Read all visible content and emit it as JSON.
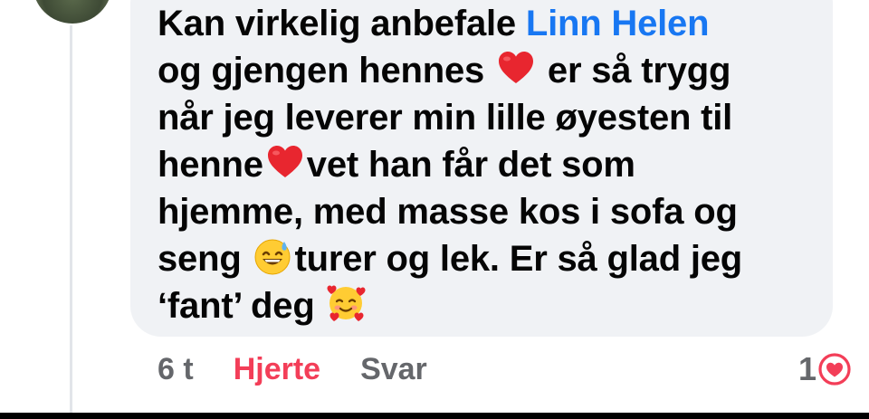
{
  "comment": {
    "line1_pre": "Kan virkelig anbefale ",
    "mention": "Linn Helen",
    "line2_pre": "og gjengen hennes ",
    "line2_post": " er så trygg",
    "line3": "når jeg leverer min lille øyesten til",
    "line4_pre": "henne",
    "line4_post": "vet han får det som",
    "line5": "hjemme, med masse kos i sofa og",
    "line6_pre": "seng ",
    "line6_post": "turer og lek. Er så glad jeg",
    "line7_pre": "‘fant’ deg "
  },
  "actions": {
    "time": "6 t",
    "heart_label": "Hjerte",
    "reply_label": "Svar"
  },
  "reactions": {
    "count": "1",
    "icon": "heart-outline-icon",
    "color": "#f33e58"
  },
  "emojis": {
    "heart": "red-heart-icon",
    "sweat_smile": "grinning-sweat-icon",
    "hearts_face": "smiling-face-with-hearts-icon"
  },
  "colors": {
    "mention": "#1877f2",
    "bubble": "#f0f2f5",
    "text": "#050505",
    "muted": "#65676b"
  }
}
